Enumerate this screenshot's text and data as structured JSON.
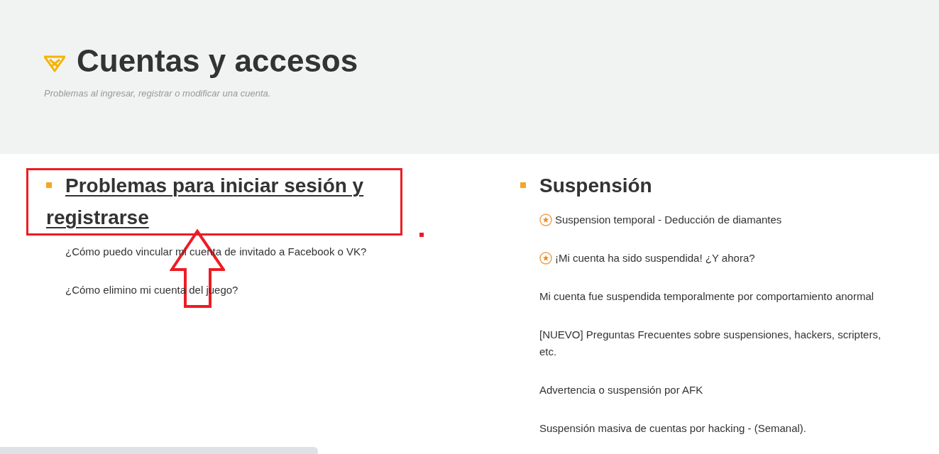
{
  "header": {
    "title": "Cuentas y accesos",
    "subtitle": "Problemas al ingresar, registrar o modificar una cuenta."
  },
  "sections": [
    {
      "title": "Problemas para iniciar sesión y registrarse",
      "linked": true,
      "items": [
        {
          "text": "¿Cómo puedo vincular mi cuenta de invitado a Facebook o VK?",
          "starred": false
        },
        {
          "text": "¿Cómo elimino mi cuenta del juego?",
          "starred": false
        }
      ]
    },
    {
      "title": "Suspensión",
      "linked": false,
      "items": [
        {
          "text": "Suspension temporal - Deducción de diamantes",
          "starred": true
        },
        {
          "text": "¡Mi cuenta ha sido suspendida! ¿Y ahora?",
          "starred": true
        },
        {
          "text": "Mi cuenta fue suspendida temporalmente por comportamiento anormal",
          "starred": false
        },
        {
          "text": "[NUEVO] Preguntas Frecuentes sobre suspensiones, hackers, scripters, etc.",
          "starred": false
        },
        {
          "text": "Advertencia o suspensión por AFK",
          "starred": false
        },
        {
          "text": "Suspensión masiva de cuentas por hacking - (Semanal).",
          "starred": false
        }
      ]
    }
  ]
}
